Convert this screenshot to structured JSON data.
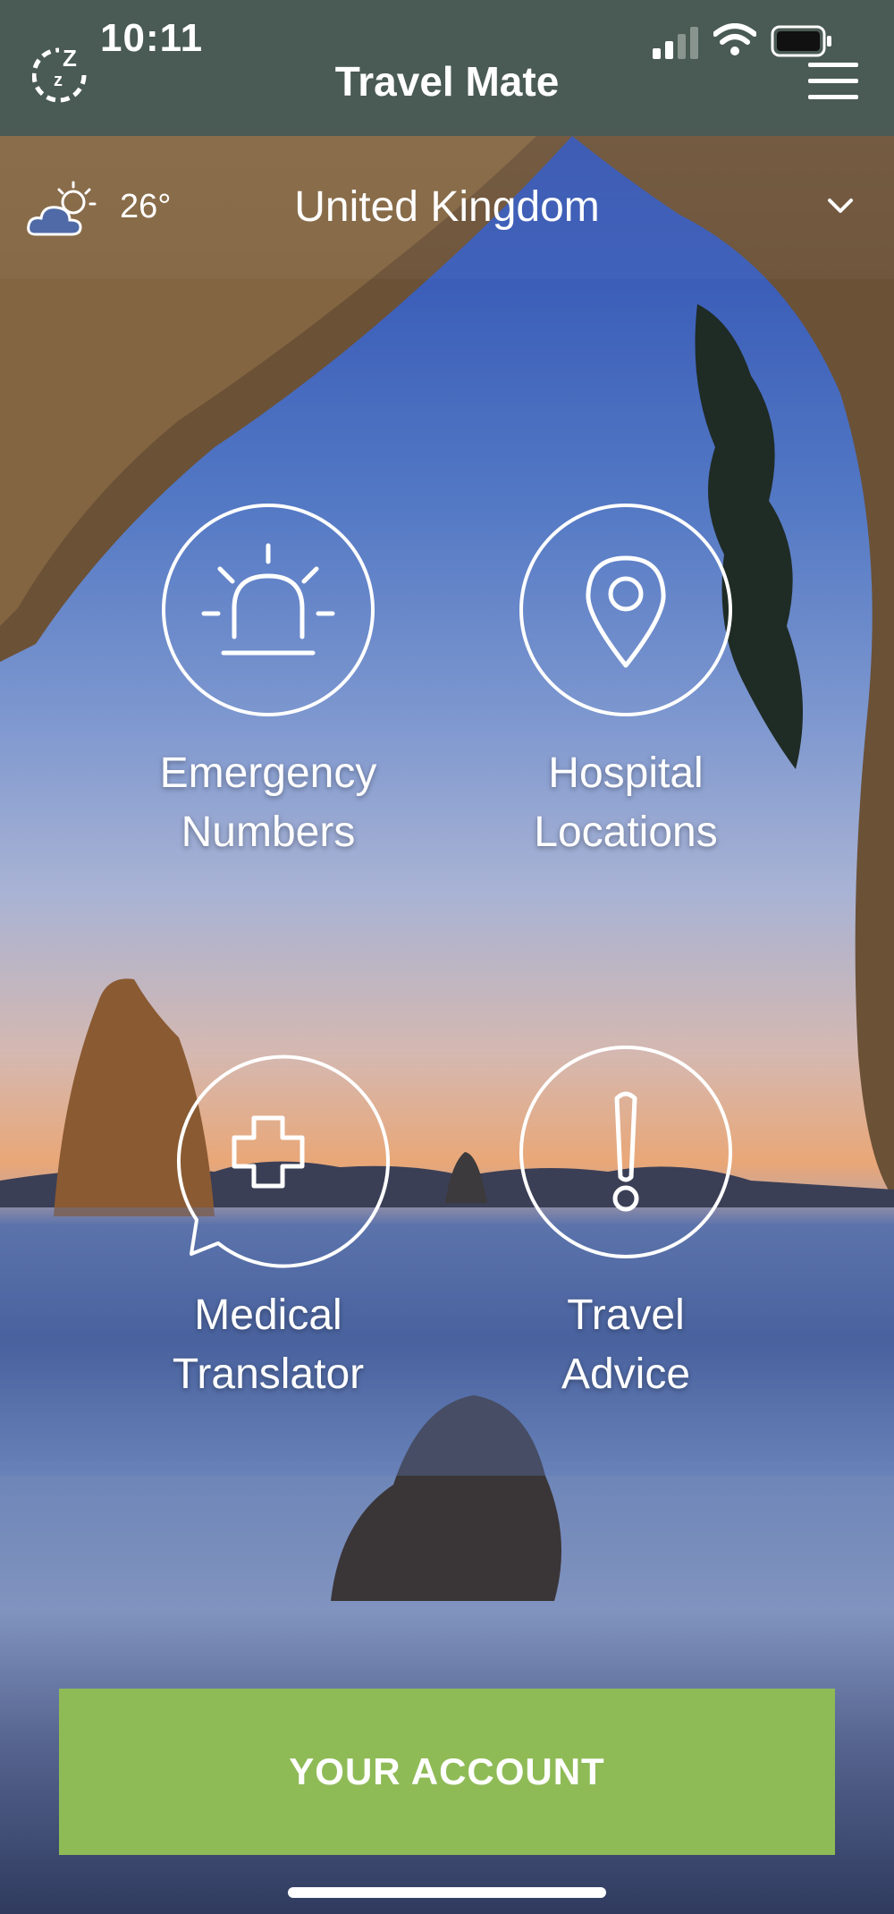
{
  "status_bar": {
    "time": "10:11"
  },
  "header": {
    "title": "Travel Mate"
  },
  "location": {
    "temperature": "26°",
    "country": "United Kingdom"
  },
  "tiles": [
    {
      "label_line1": "Emergency",
      "label_line2": "Numbers",
      "icon": "siren-icon"
    },
    {
      "label_line1": "Hospital",
      "label_line2": "Locations",
      "icon": "map-pin-icon"
    },
    {
      "label_line1": "Medical",
      "label_line2": "Translator",
      "icon": "medical-cross-chat-icon"
    },
    {
      "label_line1": "Travel",
      "label_line2": "Advice",
      "icon": "exclamation-icon"
    }
  ],
  "account_button": {
    "label": "YOUR ACCOUNT"
  },
  "colors": {
    "header_bg": "#4a5a54",
    "account_button_bg": "#8fbb57",
    "text": "#ffffff"
  }
}
